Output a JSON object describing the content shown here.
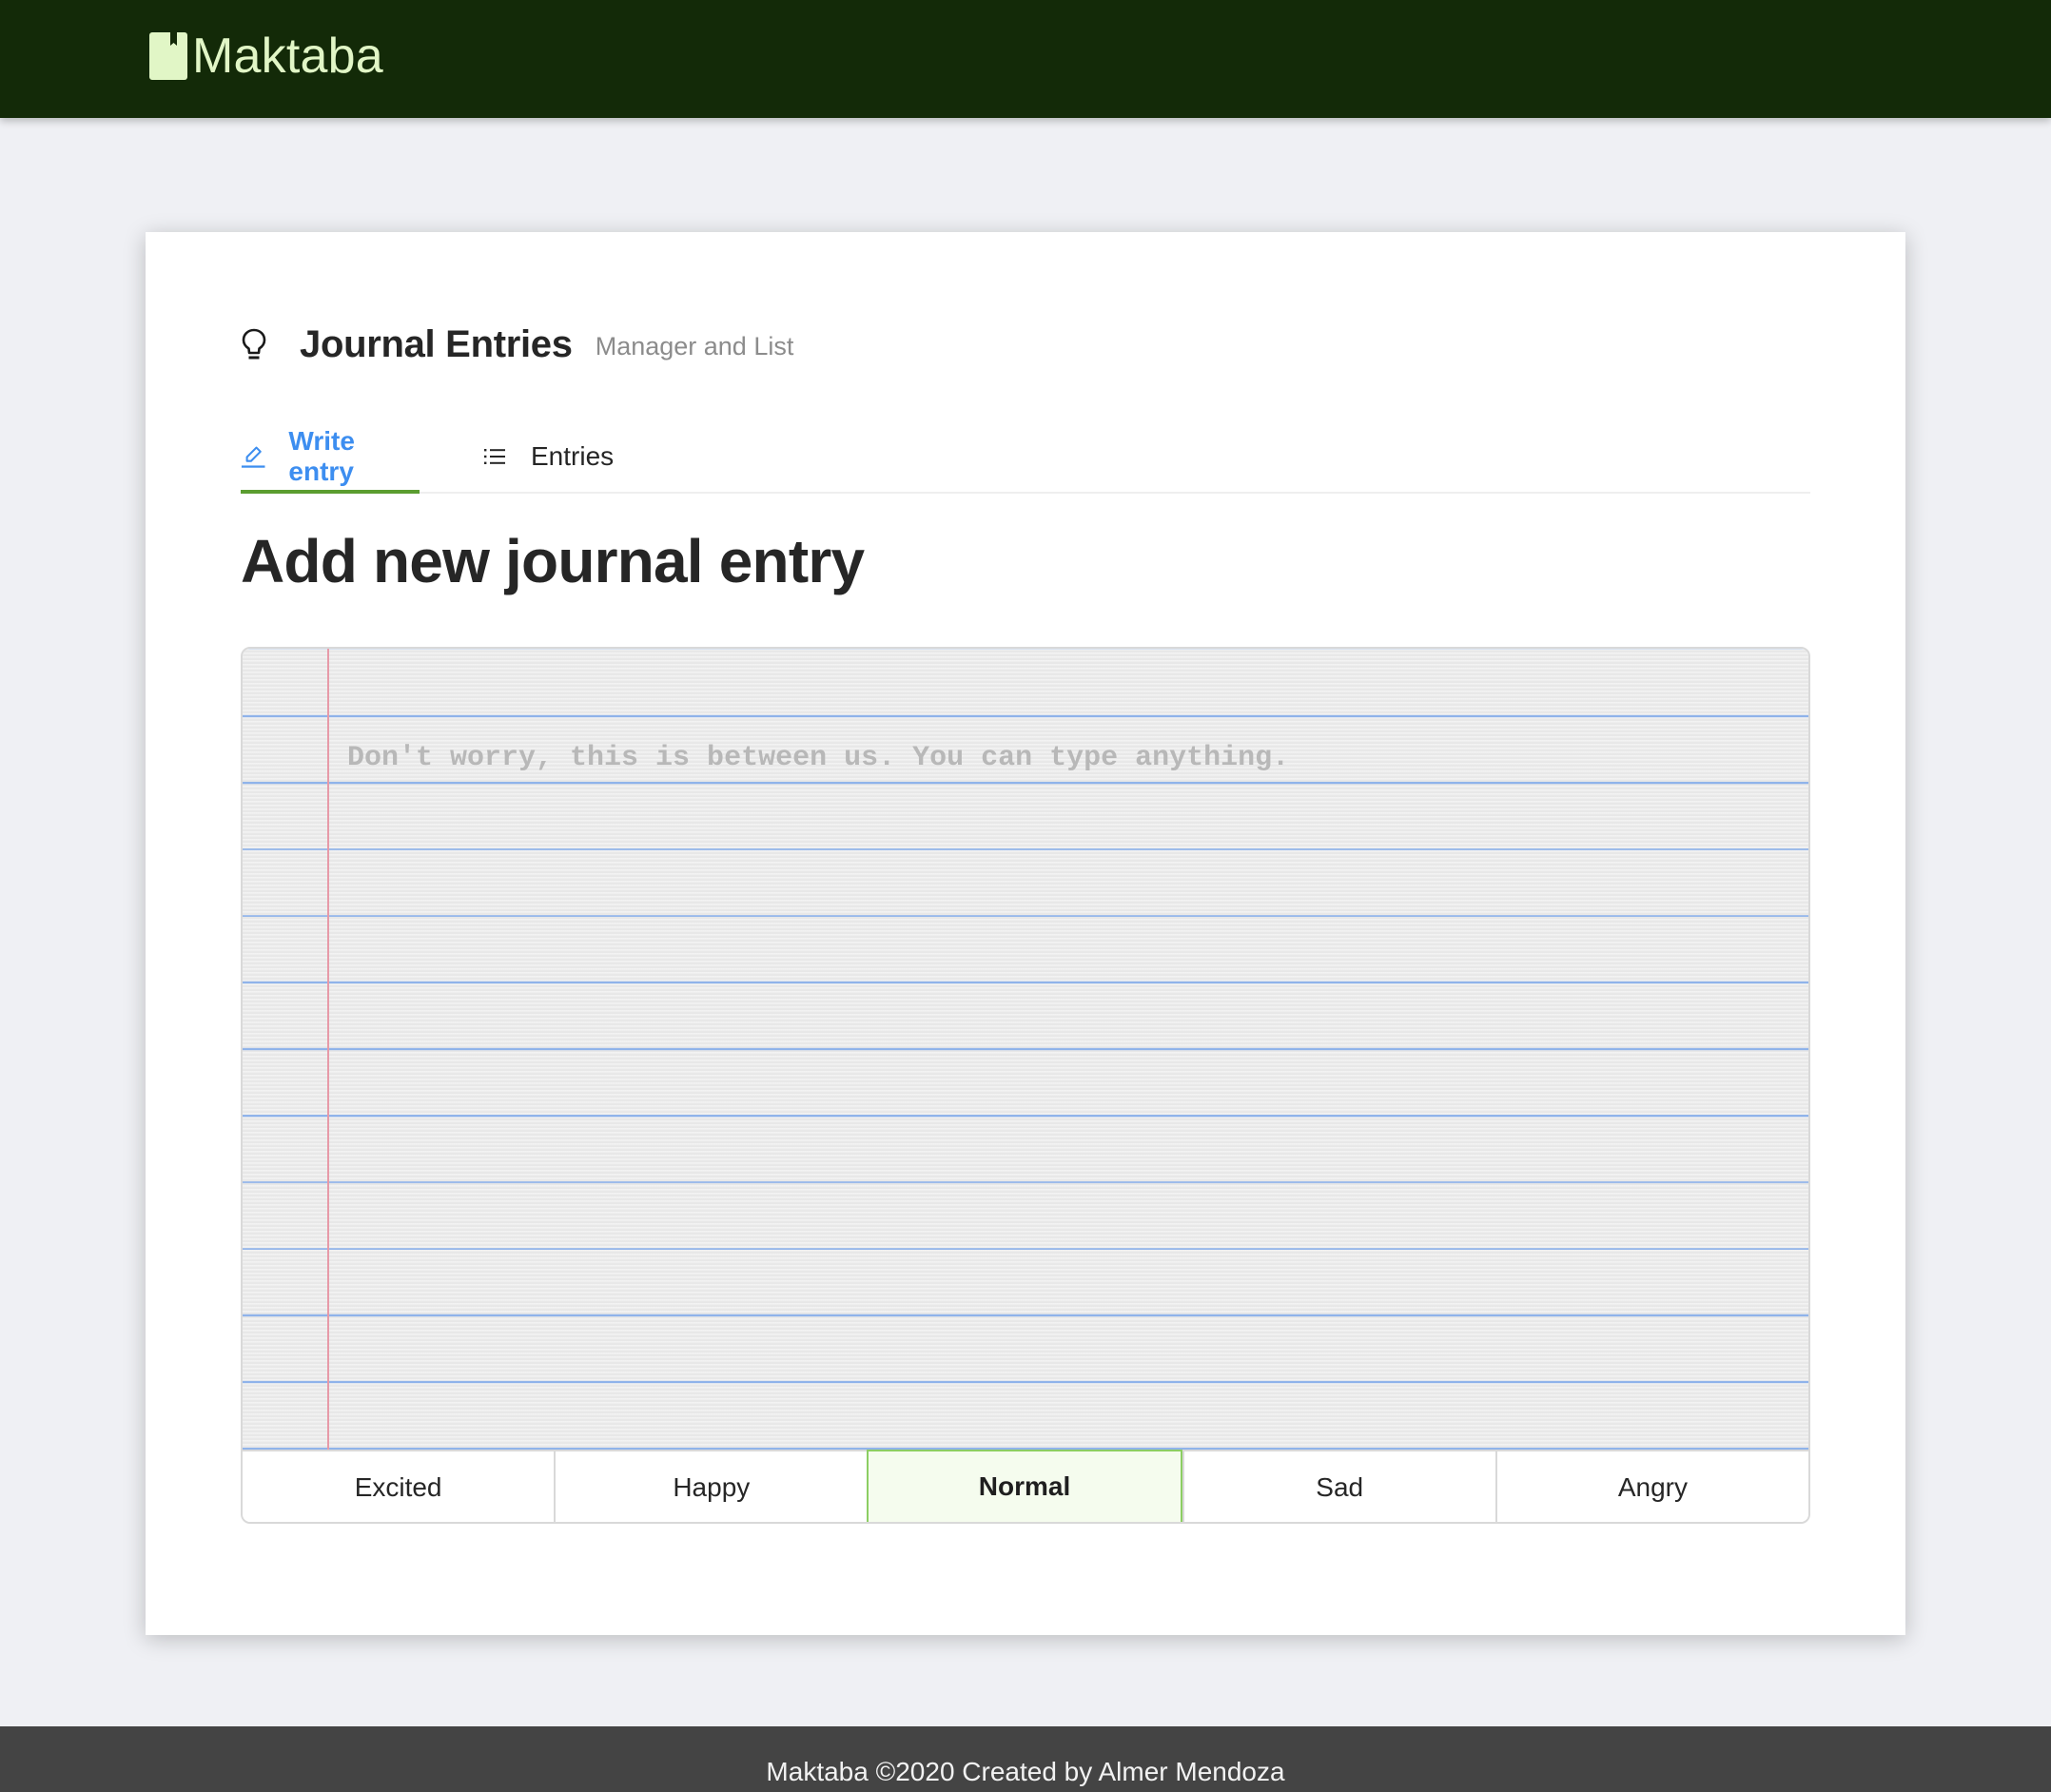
{
  "app": {
    "name": "Maktaba",
    "logo_icon": "book-bookmark-icon",
    "colors": {
      "header_bg": "#132a08",
      "logo": "#e1f6c6",
      "page_bg": "#eff0f4",
      "active_tab": "#3d8ef0",
      "ink_bar": "#5b9d30",
      "selected_mood_border": "#8cce63",
      "selected_mood_bg": "#f5fcee",
      "footer_bg": "#444444"
    }
  },
  "page_header": {
    "icon": "bulb-icon",
    "title": "Journal Entries",
    "subtitle": "Manager and List"
  },
  "tabs": [
    {
      "label": "Write entry",
      "icon": "edit-icon",
      "active": true
    },
    {
      "label": "Entries",
      "icon": "unordered-list-icon",
      "active": false
    }
  ],
  "editor": {
    "heading": "Add new journal entry",
    "value": "",
    "placeholder": "Don't worry, this is between us. You can type anything."
  },
  "moods": {
    "options": [
      "Excited",
      "Happy",
      "Normal",
      "Sad",
      "Angry"
    ],
    "selected": "Normal"
  },
  "footer": {
    "text": "Maktaba ©2020 Created by Almer Mendoza"
  }
}
